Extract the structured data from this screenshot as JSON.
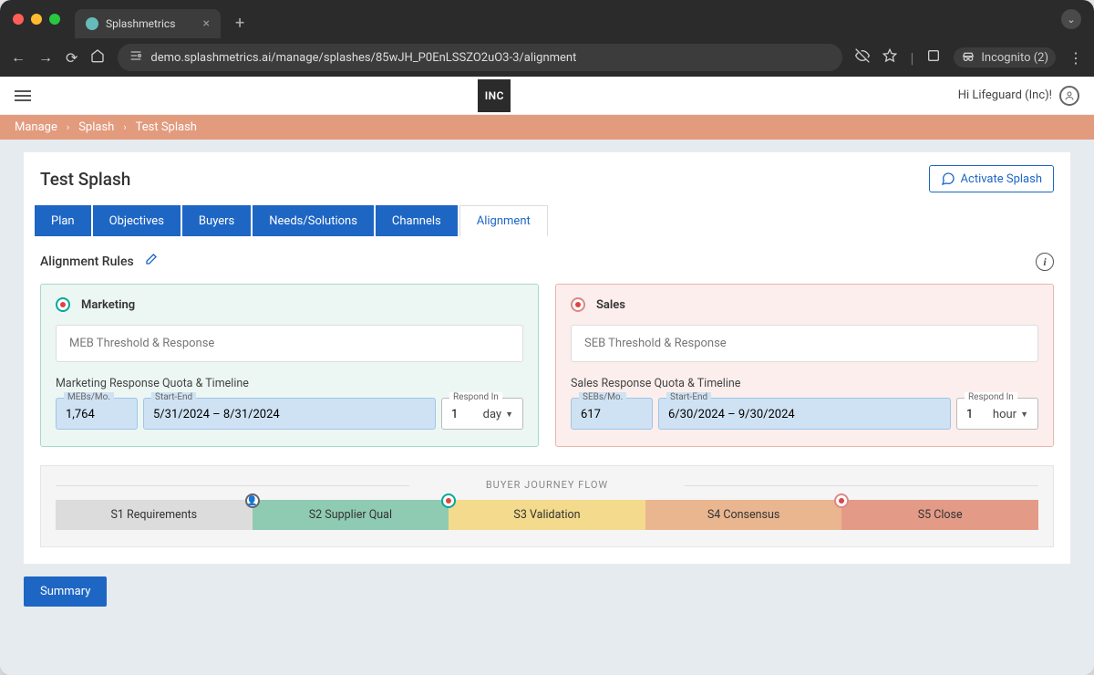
{
  "browser": {
    "tab_title": "Splashmetrics",
    "url": "demo.splashmetrics.ai/manage/splashes/85wJH_P0EnLSSZO2uO3-3/alignment",
    "incognito_label": "Incognito (2)"
  },
  "header": {
    "logo_text": "INC",
    "greeting": "Hi Lifeguard (Inc)!"
  },
  "breadcrumb": {
    "items": [
      "Manage",
      "Splash",
      "Test Splash"
    ]
  },
  "page": {
    "title": "Test Splash",
    "activate_label": "Activate Splash"
  },
  "tabs": {
    "items": [
      "Plan",
      "Objectives",
      "Buyers",
      "Needs/Solutions",
      "Channels",
      "Alignment"
    ],
    "active_index": 5
  },
  "alignment": {
    "section_title": "Alignment Rules",
    "marketing": {
      "title": "Marketing",
      "threshold_label": "MEB Threshold & Response",
      "quota_heading": "Marketing Response Quota & Timeline",
      "count_label": "MEBs/Mo.",
      "count_value": "1,764",
      "range_label": "Start-End",
      "range_value": "5/31/2024 – 8/31/2024",
      "respond_label": "Respond In",
      "respond_value": "1",
      "respond_unit": "day"
    },
    "sales": {
      "title": "Sales",
      "threshold_label": "SEB Threshold & Response",
      "quota_heading": "Sales Response Quota & Timeline",
      "count_label": "SEBs/Mo.",
      "count_value": "617",
      "range_label": "Start-End",
      "range_value": "6/30/2024 – 9/30/2024",
      "respond_label": "Respond In",
      "respond_value": "1",
      "respond_unit": "hour"
    }
  },
  "journey": {
    "heading": "BUYER JOURNEY FLOW",
    "stages": [
      "S1 Requirements",
      "S2 Supplier Qual",
      "S3 Validation",
      "S4 Consensus",
      "S5 Close"
    ]
  },
  "summary_button": "Summary"
}
